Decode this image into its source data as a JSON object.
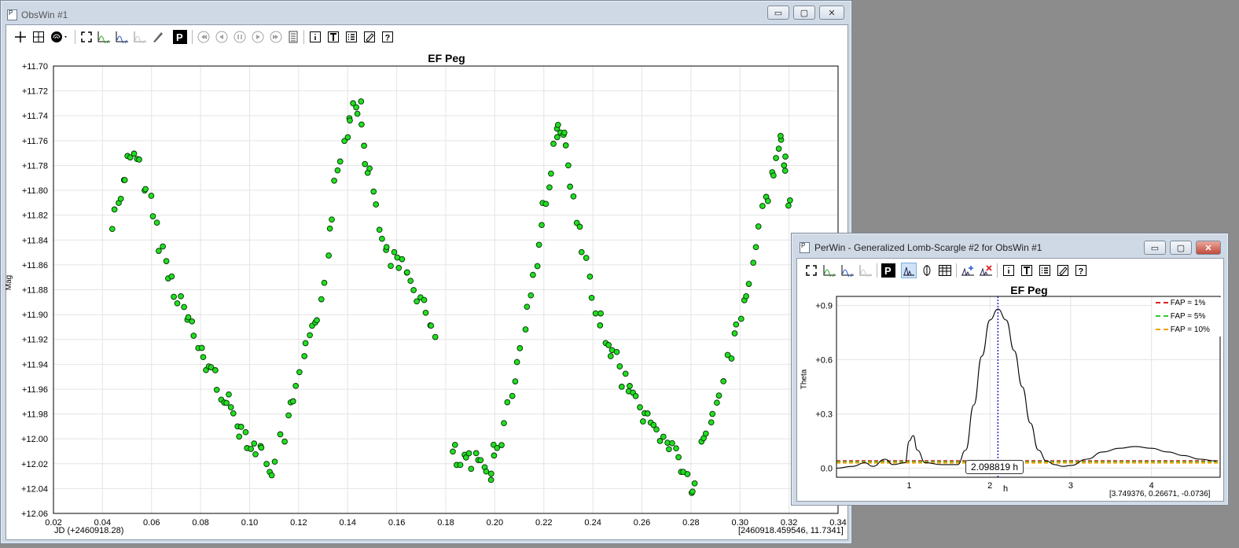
{
  "obswin": {
    "title": "ObsWin #1",
    "chart_title": "EF Peg",
    "ylabel": "Mag",
    "xlabel": "JD (+2460918.28)",
    "cursor": "[2460918.459546, 11.7341]",
    "ctrl_min": "▭",
    "ctrl_max": "▢",
    "ctrl_close": "✕"
  },
  "perwin": {
    "title": "PerWin - Generalized Lomb-Scargle #2 for ObsWin #1",
    "chart_title": "EF Peg",
    "ylabel": "Theta",
    "xlabel": "h",
    "cursor": "[3.749376, 0.26671, -0.0736]",
    "peak_label": "2.098819 h",
    "legend": [
      "FAP = 1%",
      "FAP = 5%",
      "FAP = 10%"
    ],
    "ctrl_min": "▭",
    "ctrl_max": "▢",
    "ctrl_close": "✕"
  },
  "colors": {
    "point": "#22dd22",
    "fap1": "#e02020",
    "fap5": "#33cc33",
    "fap10": "#f0a000",
    "peak_line": "#2222cc"
  },
  "chart_data": [
    {
      "type": "scatter",
      "title": "EF Peg",
      "xlabel": "JD (+2460918.28)",
      "ylabel": "Mag",
      "xlim": [
        0.02,
        0.34
      ],
      "ylim": [
        12.06,
        11.7
      ],
      "y_inverted": true,
      "grid": true,
      "xticks": [
        "0.02",
        "0.04",
        "0.06",
        "0.08",
        "0.10",
        "0.12",
        "0.14",
        "0.16",
        "0.18",
        "0.20",
        "0.22",
        "0.24",
        "0.26",
        "0.28",
        "0.30",
        "0.32",
        "0.34"
      ],
      "yticks": [
        "+11.70",
        "+11.72",
        "+11.74",
        "+11.76",
        "+11.78",
        "+11.80",
        "+11.82",
        "+11.84",
        "+11.86",
        "+11.88",
        "+11.90",
        "+11.92",
        "+11.94",
        "+11.96",
        "+11.98",
        "+12.00",
        "+12.02",
        "+12.04",
        "+12.06"
      ],
      "segments": [
        {
          "t0": 0.044,
          "t1": 0.112,
          "m0": 11.83,
          "m1": 12.03,
          "path": [
            [
              0.044,
              11.83
            ],
            [
              0.048,
              11.8
            ],
            [
              0.05,
              11.78
            ],
            [
              0.054,
              11.775
            ],
            [
              0.058,
              11.8
            ],
            [
              0.062,
              11.83
            ],
            [
              0.066,
              11.86
            ],
            [
              0.072,
              11.89
            ],
            [
              0.08,
              11.93
            ],
            [
              0.088,
              11.96
            ],
            [
              0.096,
              11.99
            ],
            [
              0.104,
              12.01
            ],
            [
              0.108,
              12.02
            ],
            [
              0.112,
              12.03
            ]
          ]
        },
        {
          "path": [
            [
              0.113,
              12.005
            ],
            [
              0.118,
              11.97
            ],
            [
              0.122,
              11.94
            ],
            [
              0.128,
              11.9
            ],
            [
              0.132,
              11.85
            ],
            [
              0.135,
              11.8
            ],
            [
              0.14,
              11.75
            ],
            [
              0.142,
              11.73
            ],
            [
              0.145,
              11.73
            ],
            [
              0.147,
              11.77
            ],
            [
              0.15,
              11.8
            ],
            [
              0.154,
              11.84
            ],
            [
              0.16,
              11.86
            ],
            [
              0.166,
              11.87
            ],
            [
              0.172,
              11.9
            ],
            [
              0.177,
              11.93
            ]
          ]
        },
        {
          "path": [
            [
              0.183,
              12.01
            ],
            [
              0.186,
              12.02
            ],
            [
              0.192,
              12.02
            ],
            [
              0.198,
              12.025
            ],
            [
              0.2,
              12.01
            ],
            [
              0.204,
              11.99
            ],
            [
              0.208,
              11.95
            ],
            [
              0.212,
              11.91
            ],
            [
              0.216,
              11.87
            ],
            [
              0.219,
              11.83
            ],
            [
              0.222,
              11.79
            ],
            [
              0.225,
              11.76
            ],
            [
              0.227,
              11.745
            ],
            [
              0.229,
              11.77
            ],
            [
              0.232,
              11.81
            ],
            [
              0.236,
              11.85
            ],
            [
              0.24,
              11.89
            ],
            [
              0.246,
              11.92
            ],
            [
              0.252,
              11.95
            ],
            [
              0.258,
              11.97
            ],
            [
              0.264,
              11.99
            ],
            [
              0.27,
              12.0
            ],
            [
              0.276,
              12.02
            ],
            [
              0.28,
              12.04
            ],
            [
              0.283,
              12.035
            ]
          ]
        },
        {
          "path": [
            [
              0.284,
              12.01
            ],
            [
              0.288,
              11.99
            ],
            [
              0.292,
              11.96
            ],
            [
              0.296,
              11.93
            ],
            [
              0.3,
              11.9
            ],
            [
              0.304,
              11.87
            ],
            [
              0.308,
              11.83
            ],
            [
              0.312,
              11.8
            ],
            [
              0.315,
              11.77
            ],
            [
              0.317,
              11.765
            ],
            [
              0.319,
              11.79
            ],
            [
              0.322,
              11.83
            ]
          ]
        }
      ]
    },
    {
      "type": "line",
      "title": "EF Peg",
      "xlabel": "h",
      "ylabel": "Theta",
      "xlim": [
        0.1,
        4.85
      ],
      "ylim": [
        -0.05,
        0.95
      ],
      "grid": true,
      "xticks": [
        "1",
        "2",
        "3",
        "4"
      ],
      "yticks": [
        "0.0",
        "+0.3",
        "+0.6",
        "+0.9"
      ],
      "fap_levels": [
        {
          "name": "FAP = 1%",
          "value": 0.04
        },
        {
          "name": "FAP = 5%",
          "value": 0.035
        },
        {
          "name": "FAP = 10%",
          "value": 0.03
        }
      ],
      "peak": 2.098819,
      "x": [
        0.1,
        0.3,
        0.45,
        0.55,
        0.7,
        0.8,
        0.95,
        1.0,
        1.05,
        1.1,
        1.2,
        1.4,
        1.6,
        1.7,
        1.8,
        1.9,
        2.0,
        2.1,
        2.2,
        2.3,
        2.4,
        2.5,
        2.6,
        2.7,
        2.8,
        2.9,
        3.0,
        3.2,
        3.4,
        3.6,
        3.8,
        4.0,
        4.2,
        4.4,
        4.6,
        4.8
      ],
      "y": [
        0.0,
        0.01,
        0.03,
        0.01,
        0.05,
        0.02,
        0.03,
        0.15,
        0.18,
        0.1,
        0.03,
        0.02,
        0.02,
        0.1,
        0.35,
        0.62,
        0.82,
        0.88,
        0.82,
        0.65,
        0.45,
        0.25,
        0.1,
        0.04,
        0.02,
        0.01,
        0.015,
        0.05,
        0.09,
        0.11,
        0.12,
        0.11,
        0.09,
        0.07,
        0.05,
        0.04
      ]
    }
  ]
}
